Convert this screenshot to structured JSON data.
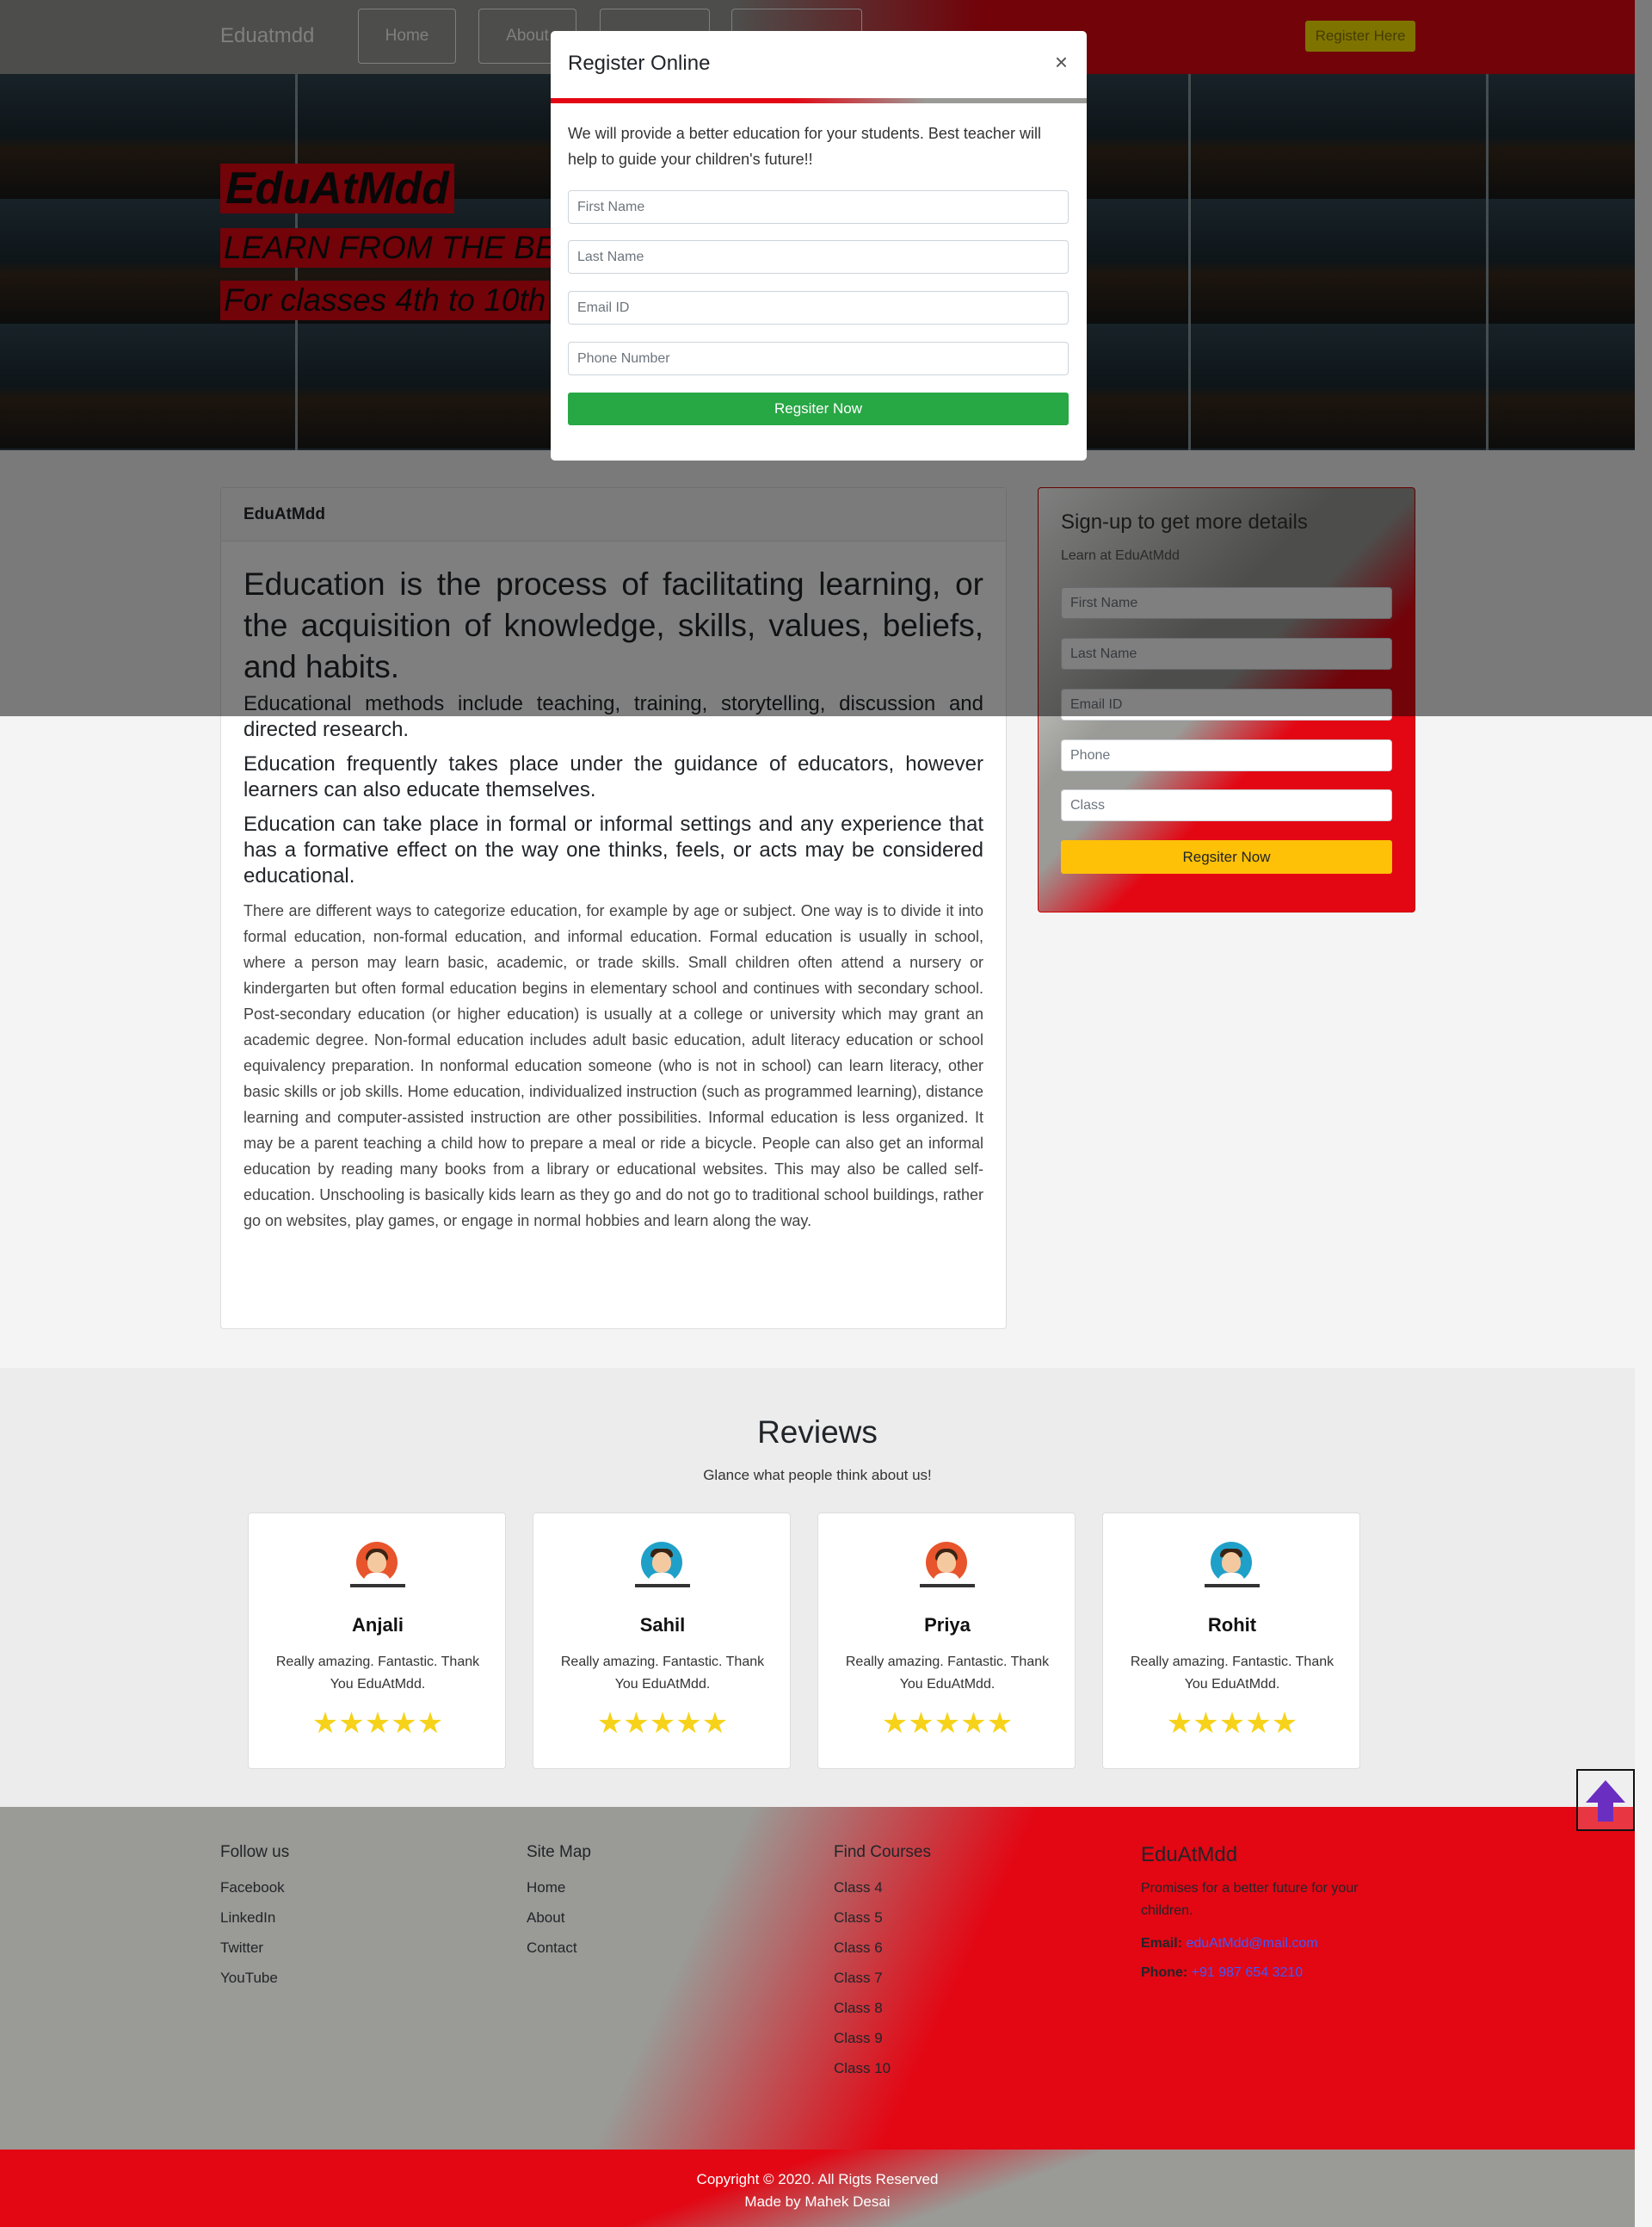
{
  "nav": {
    "brand": "Eduatmdd",
    "items": [
      "Home",
      "About",
      "",
      ""
    ],
    "register_button": "Register Here"
  },
  "hero": {
    "title": "EduAtMdd",
    "line2": "LEARN FROM THE BEST",
    "line3": "For classes 4th to 10th"
  },
  "modal": {
    "title": "Register Online",
    "close": "×",
    "text": "We will provide a better education for your students. Best teacher will help to guide your children's future!!",
    "placeholders": [
      "First Name",
      "Last Name",
      "Email ID",
      "Phone Number"
    ],
    "button": "Regsiter Now"
  },
  "article": {
    "header": "EduAtMdd",
    "lead": "Education is the process of facilitating learning, or the acquisition of knowledge, skills, values, beliefs, and habits.",
    "sub1": "Educational methods include teaching, training, storytelling, discussion and directed research.",
    "sub2": "Education frequently takes place under the guidance of educators, however learners can also educate themselves.",
    "sub3": "Education can take place in formal or informal settings and any experience that has a formative effect on the way one thinks, feels, or acts may be considered educational.",
    "body": "There are different ways to categorize education, for example by age or subject. One way is to divide it into formal education, non-formal education, and informal education. Formal education is usually in school, where a person may learn basic, academic, or trade skills. Small children often attend a nursery or kindergarten but often formal education begins in elementary school and continues with secondary school. Post-secondary education (or higher education) is usually at a college or university which may grant an academic degree. Non-formal education includes adult basic education, adult literacy education or school equivalency preparation. In nonformal education someone (who is not in school) can learn literacy, other basic skills or job skills. Home education, individualized instruction (such as programmed learning), distance learning and computer-assisted instruction are other possibilities. Informal education is less organized. It may be a parent teaching a child how to prepare a meal or ride a bicycle. People can also get an informal education by reading many books from a library or educational websites. This may also be called self-education. Unschooling is basically kids learn as they go and do not go to traditional school buildings, rather go on websites, play games, or engage in normal hobbies and learn along the way."
  },
  "signup": {
    "title": "Sign-up to get more details",
    "subtitle": "Learn at EduAtMdd",
    "placeholders": [
      "First Name",
      "Last Name",
      "Email ID",
      "Phone",
      "Class"
    ],
    "button": "Regsiter Now"
  },
  "reviews": {
    "title": "Reviews",
    "subtitle": "Glance what people think about us!",
    "items": [
      {
        "name": "Anjali",
        "text": "Really amazing. Fantastic. Thank You EduAtMdd.",
        "stars": "★★★★★",
        "rating": 5,
        "avatar": "female-avatar-icon"
      },
      {
        "name": "Sahil",
        "text": "Really amazing. Fantastic. Thank You EduAtMdd.",
        "stars": "★★★★★",
        "rating": 5,
        "avatar": "male-avatar-icon"
      },
      {
        "name": "Priya",
        "text": "Really amazing. Fantastic. Thank You EduAtMdd.",
        "stars": "★★★★★",
        "rating": 5,
        "avatar": "female-avatar-icon"
      },
      {
        "name": "Rohit",
        "text": "Really amazing. Fantastic. Thank You EduAtMdd.",
        "stars": "★★★★★",
        "rating": 5,
        "avatar": "male-avatar-icon"
      }
    ]
  },
  "footer": {
    "follow": {
      "title": "Follow us",
      "links": [
        "Facebook",
        "LinkedIn",
        "Twitter",
        "YouTube"
      ]
    },
    "sitemap": {
      "title": "Site Map",
      "links": [
        "Home",
        "About",
        "Contact"
      ]
    },
    "courses": {
      "title": "Find Courses",
      "links": [
        "Class 4",
        "Class 5",
        "Class 6",
        "Class 7",
        "Class 8",
        "Class 9",
        "Class 10"
      ]
    },
    "brand": "EduAtMdd",
    "desc": "Promises for a better future for your children.",
    "email_label": "Email:",
    "email": "eduAtMdd@mail.com",
    "phone_label": "Phone:",
    "phone": "+91 987 654 3210",
    "copyright": "Copyright © 2020. All Rigts Reserved",
    "made_by": "Made by Mahek Desai"
  },
  "colors": {
    "brand_red": "#e30613",
    "brand_grey": "#9a9a96",
    "success": "#28a745",
    "warning": "#ffc107",
    "star": "#f6d21a"
  }
}
